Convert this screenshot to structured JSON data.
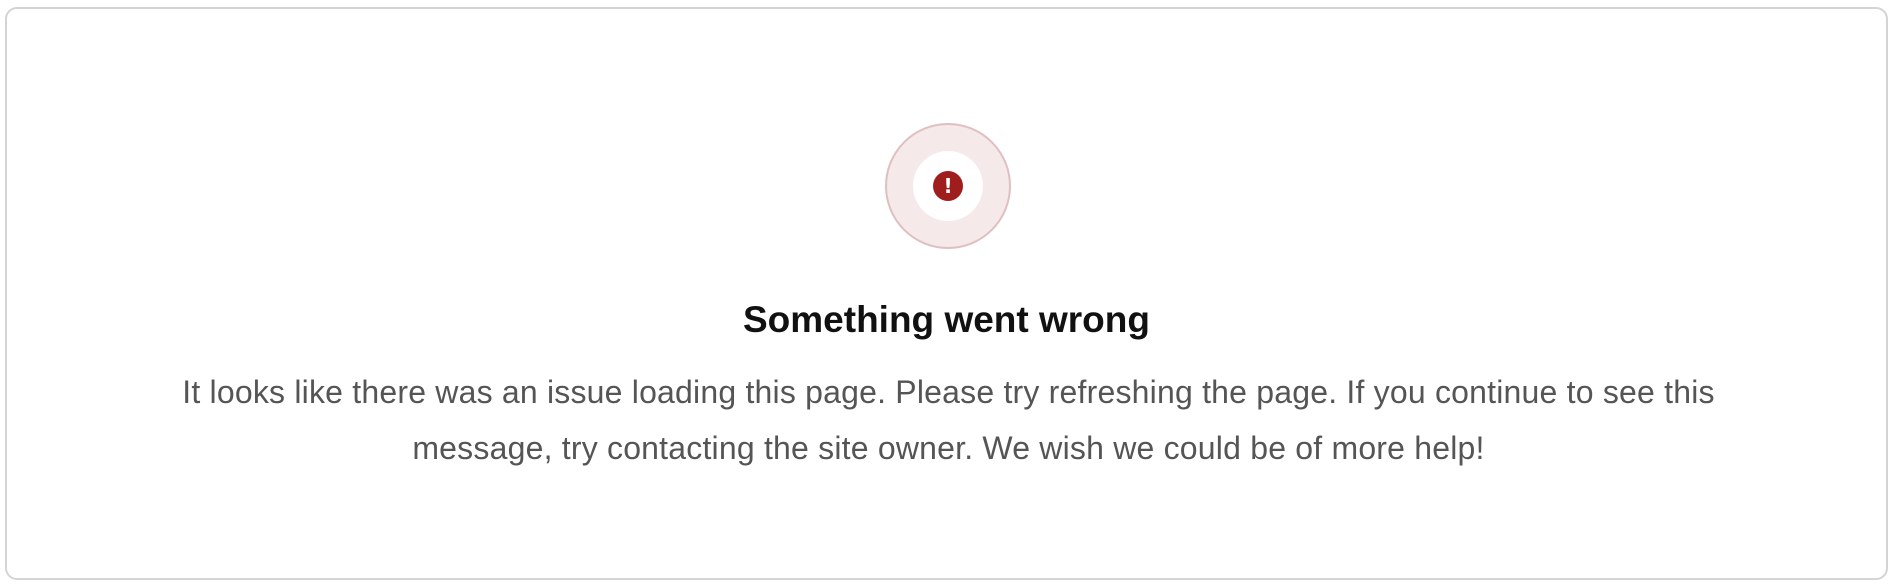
{
  "error": {
    "icon": "exclamation-icon",
    "icon_glyph": "!",
    "title": "Something went wrong",
    "message": "It looks like there was an issue loading this page. Please try refreshing the page. If you continue to see this message, try contacting the site owner. We wish we could be of more help!"
  },
  "colors": {
    "accent": "#a01d1d",
    "ring_fill": "#f6e9e9",
    "ring_border": "#dfc0c2",
    "title": "#111111",
    "message": "#555555",
    "card_border": "#d4d4d4"
  }
}
